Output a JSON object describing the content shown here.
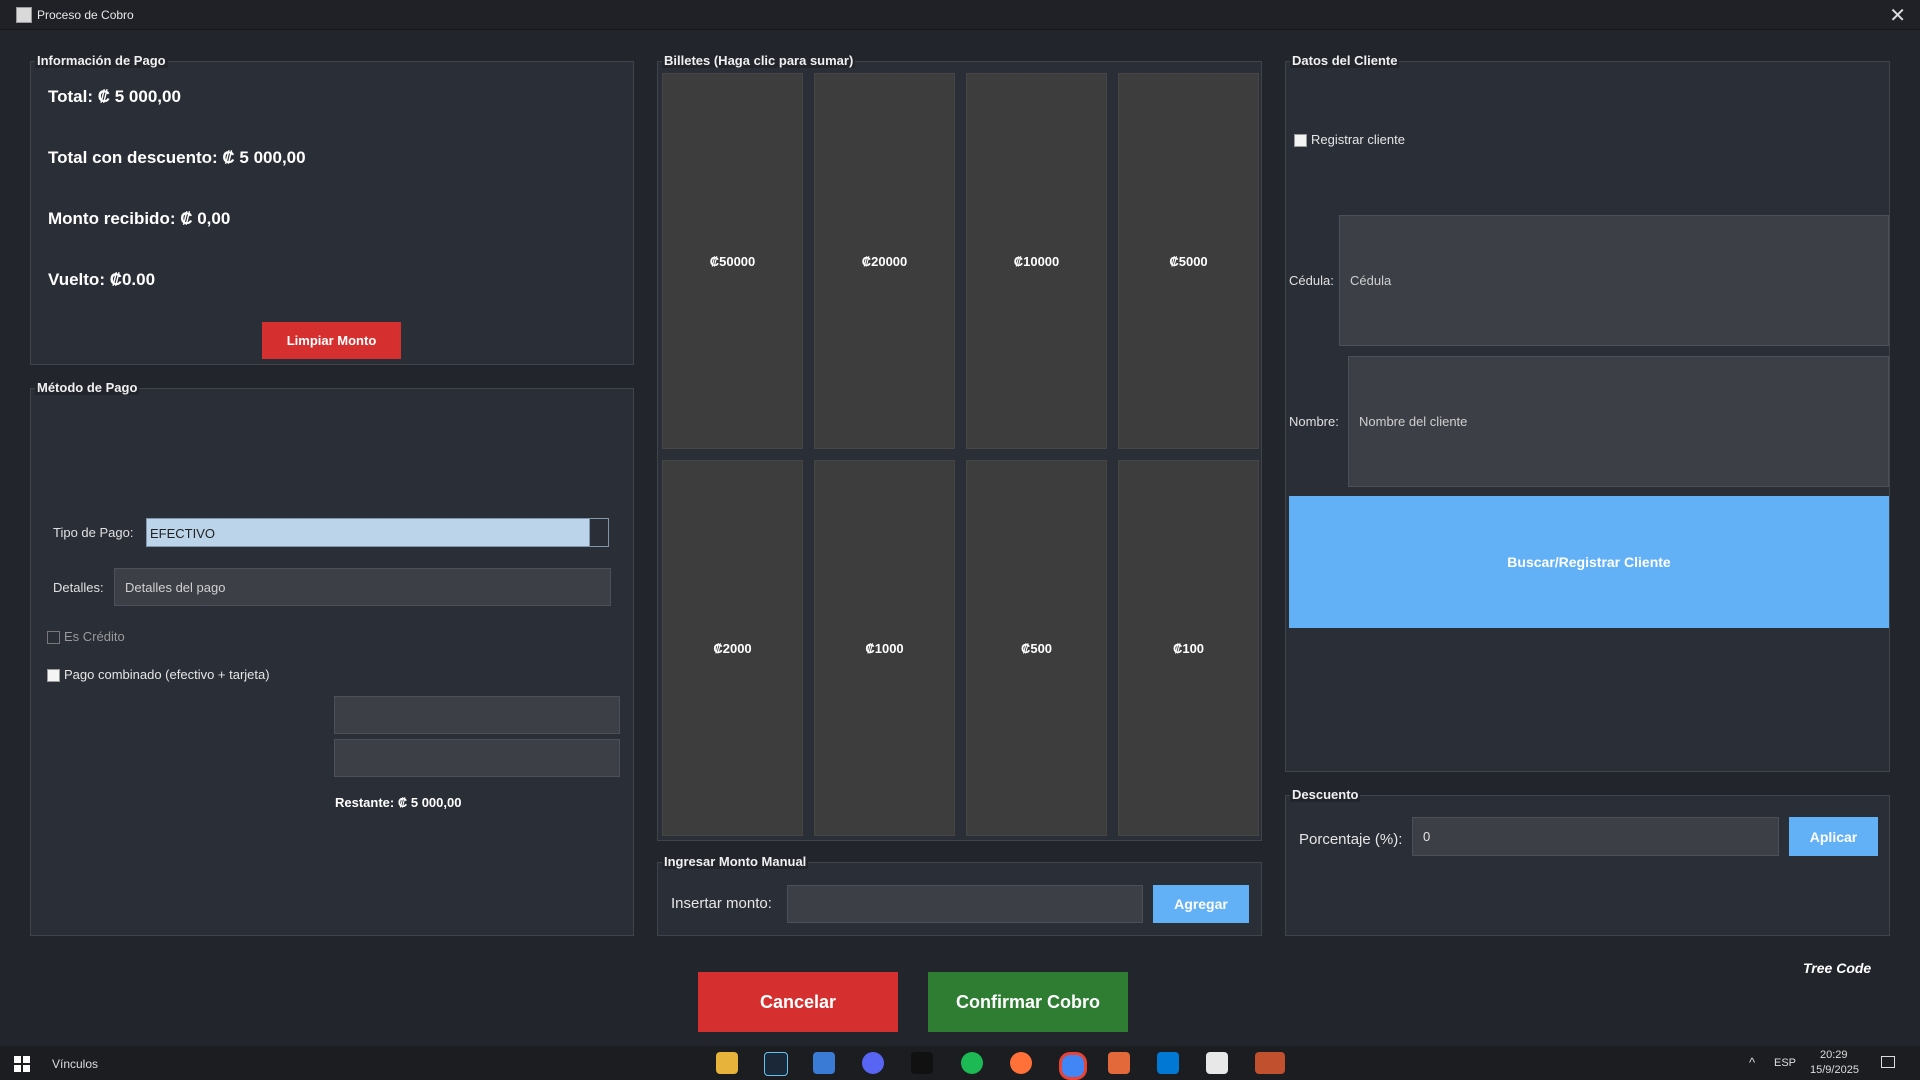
{
  "window": {
    "title": "Proceso de Cobro",
    "close_glyph": "✕"
  },
  "payment_info": {
    "legend": "Información de Pago",
    "total": "Total: ₡ 5 000,00",
    "total_discount": "Total con descuento: ₡ 5 000,00",
    "received": "Monto recibido: ₡ 0,00",
    "change": "Vuelto: ₡0.00",
    "clear_button": "Limpiar Monto"
  },
  "payment_method": {
    "legend": "Método de Pago",
    "type_label": "Tipo de Pago:",
    "type_value": "EFECTIVO",
    "details_label": "Detalles:",
    "details_placeholder": "Detalles del pago",
    "credit_label": "Es Crédito",
    "combined_label": "Pago combinado (efectivo + tarjeta)",
    "remaining": "Restante: ₡ 5 000,00"
  },
  "bills": {
    "legend": "Billetes (Haga clic para sumar)",
    "items": [
      "₡50000",
      "₡20000",
      "₡10000",
      "₡5000",
      "₡2000",
      "₡1000",
      "₡500",
      "₡100"
    ]
  },
  "manual": {
    "legend": "Ingresar Monto Manual",
    "label": "Insertar monto:",
    "button": "Agregar"
  },
  "client": {
    "legend": "Datos del Cliente",
    "register_label": "Registrar cliente",
    "cedula_label": "Cédula:",
    "cedula_placeholder": "Cédula",
    "name_label": "Nombre:",
    "name_placeholder": "Nombre del cliente",
    "button": "Buscar/Registrar Cliente"
  },
  "discount": {
    "legend": "Descuento",
    "label": "Porcentaje (%):",
    "value": "0",
    "button": "Aplicar"
  },
  "footer": {
    "cancel": "Cancelar",
    "confirm": "Confirmar Cobro",
    "brand": "Tree Code"
  },
  "taskbar": {
    "links": "Vínculos",
    "lang": "ESP",
    "time": "20:29",
    "date": "15/9/2025"
  },
  "colors": {
    "red": "#d5302f",
    "blue": "#62b1f6",
    "green": "#2e7d32"
  }
}
